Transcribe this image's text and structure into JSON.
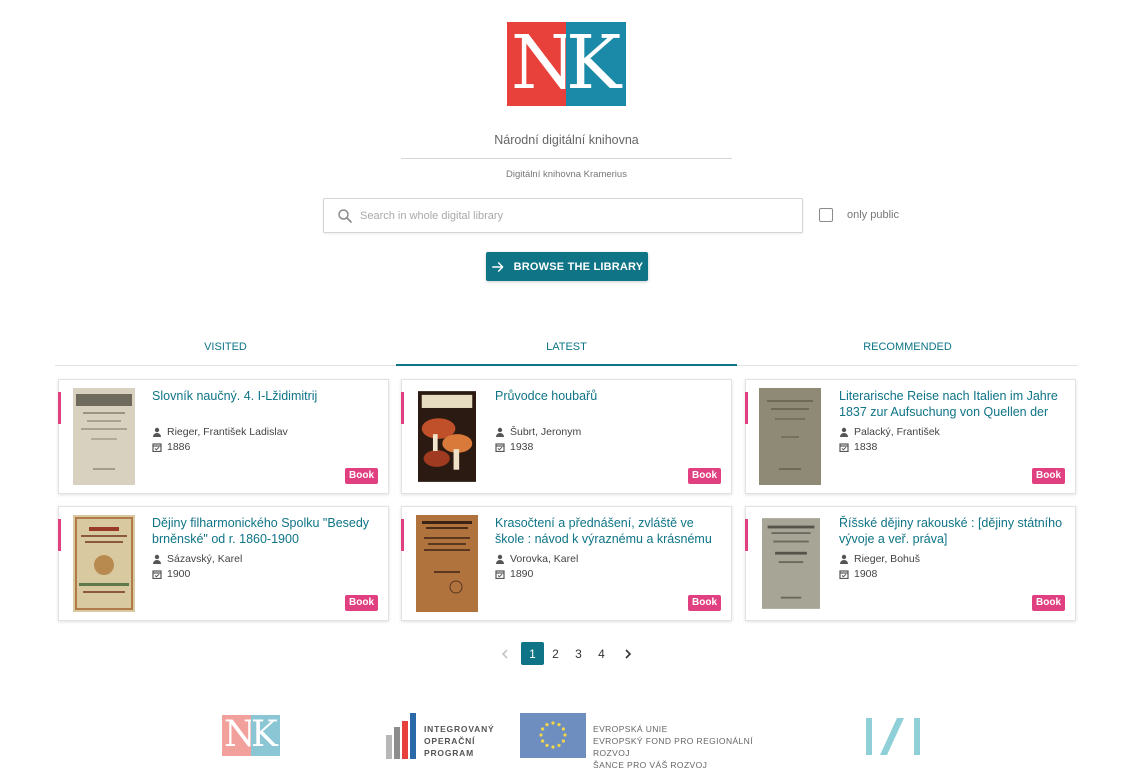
{
  "header": {
    "logo_letters": [
      "N",
      "K"
    ],
    "site_title": "Národní digitální knihovna",
    "site_subtitle": "Digitální knihovna Kramerius"
  },
  "search": {
    "placeholder": "Search in whole digital library",
    "value": "",
    "only_public_label": "only public",
    "only_public_checked": false
  },
  "browse_button": {
    "label": "BROWSE THE LIBRARY"
  },
  "tabs": [
    {
      "label": "VISITED",
      "active": false
    },
    {
      "label": "LATEST",
      "active": true
    },
    {
      "label": "RECOMMENDED",
      "active": false
    }
  ],
  "cards": [
    {
      "title": "Slovník naučný. 4. I-Lžidimitrij",
      "author": "Rieger, František Ladislav",
      "year": "1886",
      "badge": "Book"
    },
    {
      "title": "Průvodce houbařů",
      "author": "Šubrt, Jeronym",
      "year": "1938",
      "badge": "Book"
    },
    {
      "title": "Literarische Reise nach Italien im Jahre 1837 zur Aufsuchung von Quellen der",
      "author": "Palacký, František",
      "year": "1838",
      "badge": "Book"
    },
    {
      "title": "Dějiny filharmonického Spolku \"Besedy brněnské\" od r. 1860-1900",
      "author": "Sázavský, Karel",
      "year": "1900",
      "badge": "Book"
    },
    {
      "title": "Krasočtení a přednášení, zvláště ve škole : návod k výraznému a krásnému čtení a",
      "author": "Vorovka, Karel",
      "year": "1890",
      "badge": "Book"
    },
    {
      "title": "Říšské dějiny rakouské : [dějiny státního vývoje a veř. práva]",
      "author": "Rieger, Bohuš",
      "year": "1908",
      "badge": "Book"
    }
  ],
  "pagination": {
    "pages": [
      "1",
      "2",
      "3",
      "4"
    ],
    "current": "1"
  },
  "footer": {
    "iop_lines": [
      "INTEGROVANÝ",
      "OPERAČNÍ",
      "PROGRAM"
    ],
    "eu_lines": [
      "EVROPSKÁ UNIE",
      "EVROPSKÝ FOND PRO REGIONÁLNÍ ROZVOJ",
      "ŠANCE PRO VÁŠ ROZVOJ"
    ]
  },
  "colors": {
    "accent": "#0e7486",
    "badge": "#e0407f",
    "nk_red": "#e8403a",
    "nk_blue": "#1b8aa8"
  }
}
